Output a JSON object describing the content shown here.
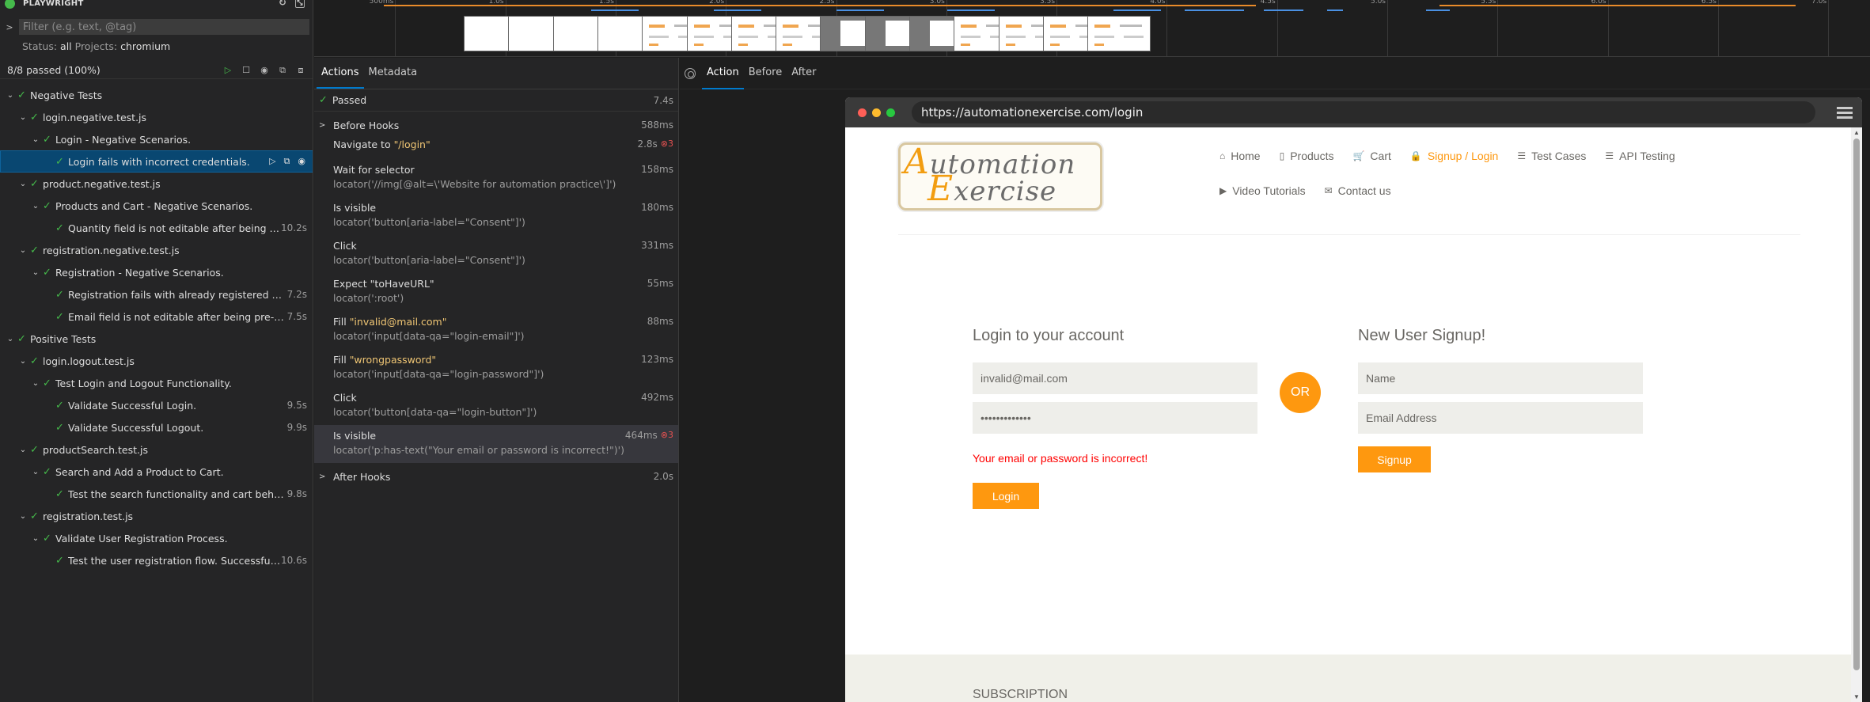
{
  "app": {
    "title": "PLAYWRIGHT"
  },
  "sidebar": {
    "filter_placeholder": "Filter (e.g. text, @tag)",
    "status_label": "Status:",
    "status_value": "all",
    "projects_label": "Projects:",
    "projects_value": "chromium",
    "summary": "8/8 passed (100%)",
    "tree": [
      {
        "label": "Negative Tests",
        "duration": "",
        "depth": 0,
        "expander": "v"
      },
      {
        "label": "login.negative.test.js",
        "duration": "",
        "depth": 1,
        "expander": "v"
      },
      {
        "label": "Login - Negative Scenarios.",
        "duration": "",
        "depth": 2,
        "expander": "v"
      },
      {
        "label": "Login fails with incorrect credentials.",
        "duration": "",
        "depth": 3,
        "expander": "",
        "selected": true
      },
      {
        "label": "product.negative.test.js",
        "duration": "",
        "depth": 1,
        "expander": "v"
      },
      {
        "label": "Products and Cart - Negative Scenarios.",
        "duration": "",
        "depth": 2,
        "expander": "v"
      },
      {
        "label": "Quantity field is not editable after being pre...",
        "duration": "10.2s",
        "depth": 3,
        "expander": ""
      },
      {
        "label": "registration.negative.test.js",
        "duration": "",
        "depth": 1,
        "expander": "v"
      },
      {
        "label": "Registration - Negative Scenarios.",
        "duration": "",
        "depth": 2,
        "expander": "v"
      },
      {
        "label": "Registration fails with already registered email.",
        "duration": "7.2s",
        "depth": 3,
        "expander": ""
      },
      {
        "label": "Email field is not editable after being pre-po...",
        "duration": "7.5s",
        "depth": 3,
        "expander": ""
      },
      {
        "label": "Positive Tests",
        "duration": "",
        "depth": 0,
        "expander": "v"
      },
      {
        "label": "login.logout.test.js",
        "duration": "",
        "depth": 1,
        "expander": "v"
      },
      {
        "label": "Test Login and Logout Functionality.",
        "duration": "",
        "depth": 2,
        "expander": "v"
      },
      {
        "label": "Validate Successful Login.",
        "duration": "9.5s",
        "depth": 3,
        "expander": ""
      },
      {
        "label": "Validate Successful Logout.",
        "duration": "9.9s",
        "depth": 3,
        "expander": ""
      },
      {
        "label": "productSearch.test.js",
        "duration": "",
        "depth": 1,
        "expander": "v"
      },
      {
        "label": "Search and Add a Product to Cart.",
        "duration": "",
        "depth": 2,
        "expander": "v"
      },
      {
        "label": "Test the search functionality and cart behavior.",
        "duration": "9.8s",
        "depth": 3,
        "expander": ""
      },
      {
        "label": "registration.test.js",
        "duration": "",
        "depth": 1,
        "expander": "v"
      },
      {
        "label": "Validate User Registration Process.",
        "duration": "",
        "depth": 2,
        "expander": "v"
      },
      {
        "label": "Test the user registration flow. Successful Re...",
        "duration": "10.6s",
        "depth": 3,
        "expander": ""
      }
    ]
  },
  "timeline": {
    "ticks": [
      "500ms",
      "1.0s",
      "1.5s",
      "2.0s",
      "2.5s",
      "3.0s",
      "3.5s",
      "4.0s",
      "4.5s",
      "5.0s",
      "5.5s",
      "6.0s",
      "6.5s",
      "7.0s"
    ]
  },
  "actions_pane": {
    "tabs": [
      "Actions",
      "Metadata"
    ],
    "passed_label": "Passed",
    "passed_duration": "7.4s",
    "items": [
      {
        "kind": "hook",
        "title": "Before Hooks",
        "duration": "588ms"
      },
      {
        "kind": "action",
        "title": "Navigate to ",
        "arg": "\"/login\"",
        "duration": "2.8s",
        "errors": "3",
        "locator": ""
      },
      {
        "kind": "action",
        "title": "Wait for selector",
        "arg": "",
        "duration": "158ms",
        "errors": "",
        "locator": "locator('//img[@alt=\\'Website for automation practice\\']')"
      },
      {
        "kind": "action",
        "title": "Is visible",
        "arg": "",
        "duration": "180ms",
        "errors": "",
        "locator": "locator('button[aria-label=\"Consent\"]')"
      },
      {
        "kind": "action",
        "title": "Click",
        "arg": "",
        "duration": "331ms",
        "errors": "",
        "locator": "locator('button[aria-label=\"Consent\"]')"
      },
      {
        "kind": "action",
        "title": "Expect \"toHaveURL\"",
        "arg": "",
        "duration": "55ms",
        "errors": "",
        "locator": "locator(':root')"
      },
      {
        "kind": "action",
        "title": "Fill ",
        "arg": "\"invalid@mail.com\"",
        "duration": "88ms",
        "errors": "",
        "locator": "locator('input[data-qa=\"login-email\"]')"
      },
      {
        "kind": "action",
        "title": "Fill ",
        "arg": "\"wrongpassword\"",
        "duration": "123ms",
        "errors": "",
        "locator": "locator('input[data-qa=\"login-password\"]')"
      },
      {
        "kind": "action",
        "title": "Click",
        "arg": "",
        "duration": "492ms",
        "errors": "",
        "locator": "locator('button[data-qa=\"login-button\"]')"
      },
      {
        "kind": "action",
        "title": "Is visible",
        "arg": "",
        "duration": "464ms",
        "errors": "3",
        "locator": "locator('p:has-text(\"Your email or password is incorrect!\")')",
        "highlighted": true
      },
      {
        "kind": "hook",
        "title": "After Hooks",
        "duration": "2.0s"
      }
    ]
  },
  "snapshot": {
    "tabs": [
      "Action",
      "Before",
      "After"
    ],
    "url": "https://automationexercise.com/login",
    "logo_word1": "utomation",
    "logo_letter1": "A",
    "logo_word2": "xercise",
    "logo_letter2": "E",
    "nav": [
      {
        "label": "Home",
        "icon": "home-icon",
        "glyph": "⌂"
      },
      {
        "label": "Products",
        "icon": "products-icon",
        "glyph": "▯"
      },
      {
        "label": "Cart",
        "icon": "cart-icon",
        "glyph": "🛒"
      },
      {
        "label": "Signup / Login",
        "icon": "lock-icon",
        "glyph": "🔒",
        "active": true
      },
      {
        "label": "Test Cases",
        "icon": "list-icon",
        "glyph": "☰"
      },
      {
        "label": "API Testing",
        "icon": "list-icon",
        "glyph": "☰"
      },
      {
        "label": "Video Tutorials",
        "icon": "youtube-icon",
        "glyph": "▶"
      },
      {
        "label": "Contact us",
        "icon": "envelope-icon",
        "glyph": "✉"
      }
    ],
    "login_heading": "Login to your account",
    "login_email_value": "invalid@mail.com",
    "login_password_value": "•••••••••••••",
    "error_message": "Your email or password is incorrect!",
    "login_button": "Login",
    "or_label": "OR",
    "signup_heading": "New User Signup!",
    "signup_name_placeholder": "Name",
    "signup_email_placeholder": "Email Address",
    "signup_button": "Signup",
    "subscription_heading": "SUBSCRIPTION"
  }
}
